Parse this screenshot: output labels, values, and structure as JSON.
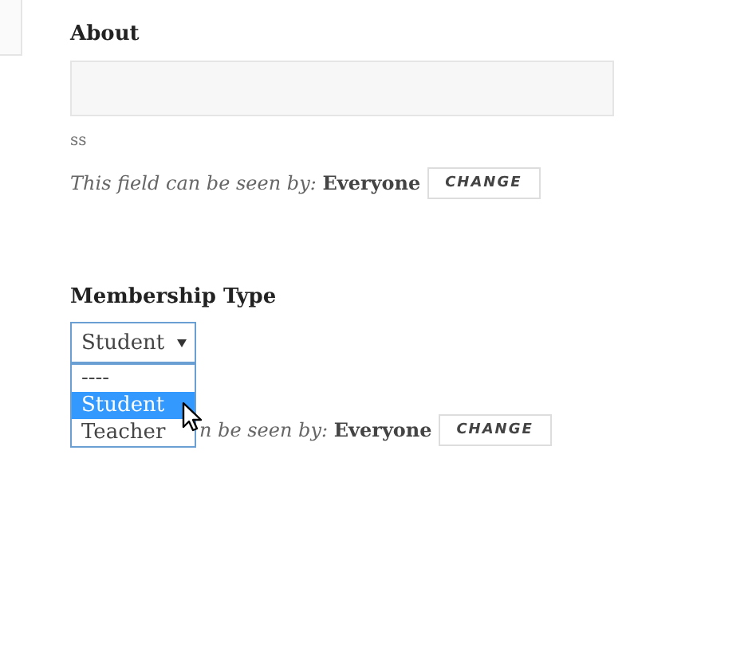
{
  "about": {
    "label": "About",
    "note": "ss",
    "visibility": {
      "text": "This field can be seen by:",
      "audience": "Everyone",
      "button": "CHANGE"
    }
  },
  "membership": {
    "label": "Membership Type",
    "select": {
      "value": "Student",
      "expanded": true,
      "options": [
        {
          "label": "----",
          "selected": false
        },
        {
          "label": "Student",
          "selected": true
        },
        {
          "label": "Teacher",
          "selected": false
        }
      ]
    },
    "visibility": {
      "text": "n be seen by:",
      "audience": "Everyone",
      "button": "CHANGE"
    }
  }
}
